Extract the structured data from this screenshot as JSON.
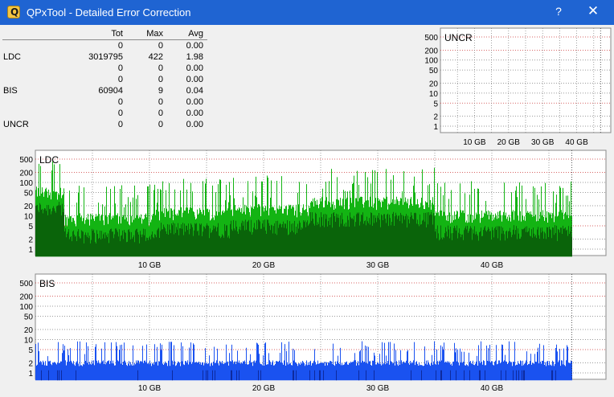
{
  "window": {
    "title": "QPxTool - Detailed Error Correction",
    "help_label": "?",
    "close_label": "✕",
    "app_icon": "Q"
  },
  "stats": {
    "headers": [
      "Tot",
      "Max",
      "Avg"
    ],
    "rows": [
      {
        "label": "",
        "tot": "0",
        "max": "0",
        "avg": "0.00"
      },
      {
        "label": "LDC",
        "tot": "3019795",
        "max": "422",
        "avg": "1.98"
      },
      {
        "label": "",
        "tot": "0",
        "max": "0",
        "avg": "0.00"
      },
      {
        "label": "",
        "tot": "0",
        "max": "0",
        "avg": "0.00"
      },
      {
        "label": "BIS",
        "tot": "60904",
        "max": "9",
        "avg": "0.04"
      },
      {
        "label": "",
        "tot": "0",
        "max": "0",
        "avg": "0.00"
      },
      {
        "label": "",
        "tot": "0",
        "max": "0",
        "avg": "0.00"
      },
      {
        "label": "UNCR",
        "tot": "0",
        "max": "0",
        "avg": "0.00"
      }
    ]
  },
  "colors": {
    "titlebar": "#1f64d2",
    "ldc_light": "#13b413",
    "ldc_dark": "#0a640a",
    "bis": "#1a52f0",
    "bis_dark": "#0d2a9e",
    "threshold": "#cc3333",
    "grid": "#7a7a7a"
  },
  "chart_data": [
    {
      "id": "uncr",
      "title": "UNCR",
      "type": "bar",
      "scale": "log",
      "y_ticks": [
        "500",
        "200",
        "100",
        "50",
        "20",
        "10",
        "5",
        "2",
        "1"
      ],
      "y_tick_values": [
        500,
        200,
        100,
        50,
        20,
        10,
        5,
        2,
        1
      ],
      "x_ticks": [
        "10 GB",
        "20 GB",
        "30 GB",
        "40 GB"
      ],
      "x_tick_values": [
        10,
        20,
        30,
        40
      ],
      "xlim": [
        0,
        50
      ],
      "series": [],
      "grid": true,
      "end_marker_gb": 47
    },
    {
      "id": "ldc",
      "title": "LDC",
      "type": "bar",
      "scale": "log",
      "y_ticks": [
        "500",
        "200",
        "100",
        "50",
        "20",
        "10",
        "5",
        "2",
        "1"
      ],
      "y_tick_values": [
        500,
        200,
        100,
        50,
        20,
        10,
        5,
        2,
        1
      ],
      "x_ticks": [
        "10 GB",
        "20 GB",
        "30 GB",
        "40 GB"
      ],
      "x_tick_values": [
        10,
        20,
        30,
        40
      ],
      "xlim": [
        0,
        50
      ],
      "grid": true,
      "data_end_gb": 47,
      "max_value": 422,
      "envelope_segments": [
        {
          "from_gb": 0,
          "to_gb": 2.5,
          "base": 50
        },
        {
          "from_gb": 2.5,
          "to_gb": 10.5,
          "base": 8
        },
        {
          "from_gb": 10.5,
          "to_gb": 17,
          "base": 12
        },
        {
          "from_gb": 17,
          "to_gb": 24,
          "base": 15
        },
        {
          "from_gb": 24,
          "to_gb": 35,
          "base": 25
        },
        {
          "from_gb": 35,
          "to_gb": 47,
          "base": 10
        }
      ]
    },
    {
      "id": "bis",
      "title": "BIS",
      "type": "bar",
      "scale": "log",
      "y_ticks": [
        "500",
        "200",
        "100",
        "50",
        "20",
        "10",
        "5",
        "2",
        "1"
      ],
      "y_tick_values": [
        500,
        200,
        100,
        50,
        20,
        10,
        5,
        2,
        1
      ],
      "x_ticks": [
        "10 GB",
        "20 GB",
        "30 GB",
        "40 GB"
      ],
      "x_tick_values": [
        10,
        20,
        30,
        40
      ],
      "xlim": [
        0,
        50
      ],
      "grid": true,
      "data_end_gb": 47,
      "max_value": 9,
      "base_value": 2
    }
  ]
}
